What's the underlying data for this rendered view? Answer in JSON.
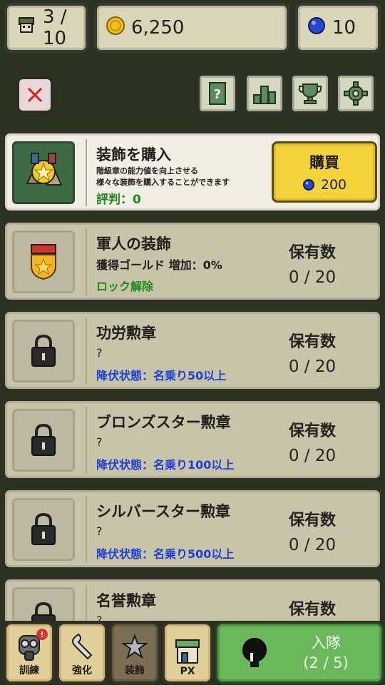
{
  "top": {
    "soldiers": "3 / 10",
    "gold": "6,250",
    "gems": "10"
  },
  "toolbar": {
    "close_icon": "close-icon",
    "buttons": [
      "guide-icon",
      "rank-icon",
      "trophy-icon",
      "gear-icon"
    ]
  },
  "featured": {
    "title": "装飾を購入",
    "desc1": "階級章の能力値を向上させる",
    "desc2": "様々な装飾を購入することができます",
    "reputation": "評判：0",
    "buy_label": "購買",
    "price": "200"
  },
  "owned_label": "保有数",
  "items": [
    {
      "title": "軍人の装飾",
      "line1": "獲得ゴールド 増加：0%",
      "line2": "ロック解除",
      "count": "0 / 20",
      "locked": false
    },
    {
      "title": "功労勲章",
      "line1": "?",
      "line2": "降伏状態：名乗り50以上",
      "count": "0 / 20",
      "locked": true
    },
    {
      "title": "ブロンズスター勲章",
      "line1": "?",
      "line2": "降伏状態：名乗り100以上",
      "count": "0 / 20",
      "locked": true
    },
    {
      "title": "シルバースター勲章",
      "line1": "?",
      "line2": "降伏状態：名乗り500以上",
      "count": "0 / 20",
      "locked": true
    },
    {
      "title": "名誉勲章",
      "line1": "?",
      "line2": "",
      "count": "",
      "locked": true
    }
  ],
  "tabs": [
    {
      "label": "訓練",
      "badge": "!"
    },
    {
      "label": "強化"
    },
    {
      "label": "装飾"
    },
    {
      "label": "PX"
    }
  ],
  "enlist": {
    "label": "入隊",
    "count": "(2 / 5)"
  },
  "colors": {
    "accent_yellow": "#f2d33c",
    "green_button": "#6bb85a",
    "link_blue": "#1e3fd4",
    "ok_green": "#1e8a1e"
  }
}
